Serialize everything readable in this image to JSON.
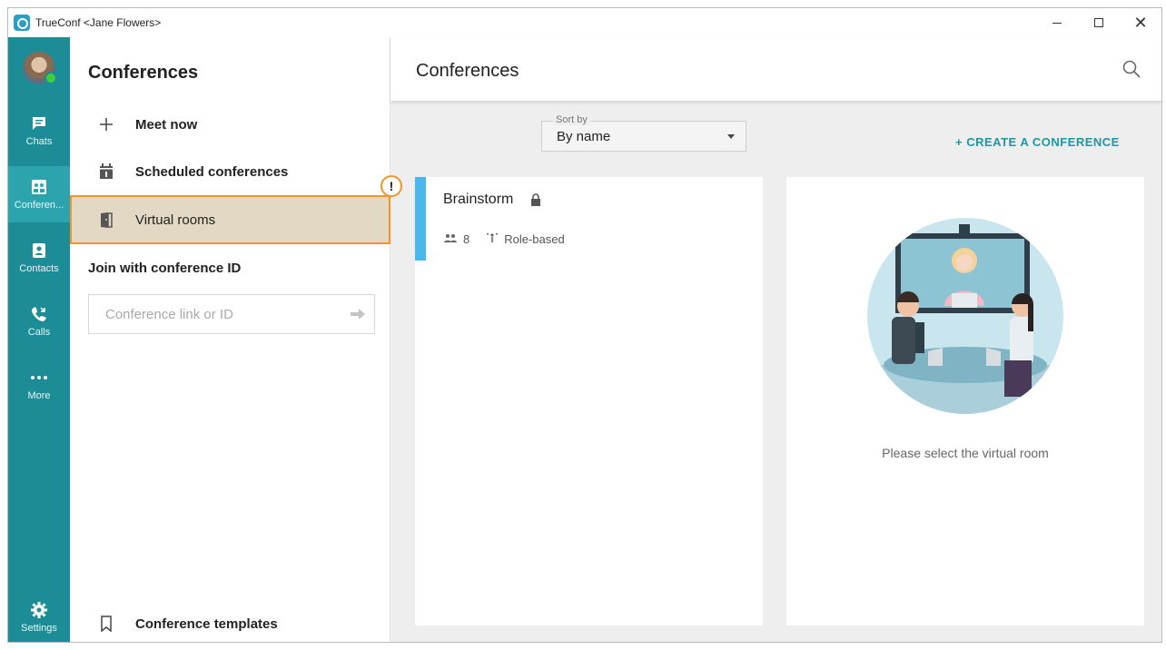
{
  "window": {
    "title": "TrueConf <Jane Flowers>",
    "controls": {
      "minimize": "minimize",
      "maximize": "maximize",
      "close": "close"
    }
  },
  "rail": {
    "items": [
      {
        "label": "Chats",
        "icon": "chat-icon"
      },
      {
        "label": "Conferen...",
        "icon": "conference-icon",
        "active": true
      },
      {
        "label": "Contacts",
        "icon": "contacts-icon"
      },
      {
        "label": "Calls",
        "icon": "calls-icon"
      },
      {
        "label": "More",
        "icon": "more-icon"
      }
    ],
    "settings": {
      "label": "Settings",
      "icon": "gear-icon"
    }
  },
  "leftpanel": {
    "title": "Conferences",
    "items": [
      {
        "label": "Meet now",
        "icon": "plus-icon"
      },
      {
        "label": "Scheduled conferences",
        "icon": "calendar-icon"
      },
      {
        "label": "Virtual rooms",
        "icon": "door-icon",
        "highlighted": true
      }
    ],
    "alert_badge": "!",
    "join_title": "Join with conference ID",
    "join_placeholder": "Conference link or ID",
    "templates_label": "Conference templates"
  },
  "main": {
    "title": "Conferences",
    "sort": {
      "label": "Sort by",
      "value": "By name"
    },
    "create_label": "+ CREATE A CONFERENCE",
    "rooms": [
      {
        "name": "Brainstorm",
        "locked": true,
        "participants": "8",
        "mode": "Role-based"
      }
    ],
    "empty_text": "Please select the virtual room"
  },
  "colors": {
    "rail": "#1c8d96",
    "rail_active": "#2ba4ae",
    "accent": "#1c97a3",
    "highlight_border": "#f0952b",
    "highlight_fill": "#e2d8c4",
    "room_accent": "#4ab7ec"
  }
}
